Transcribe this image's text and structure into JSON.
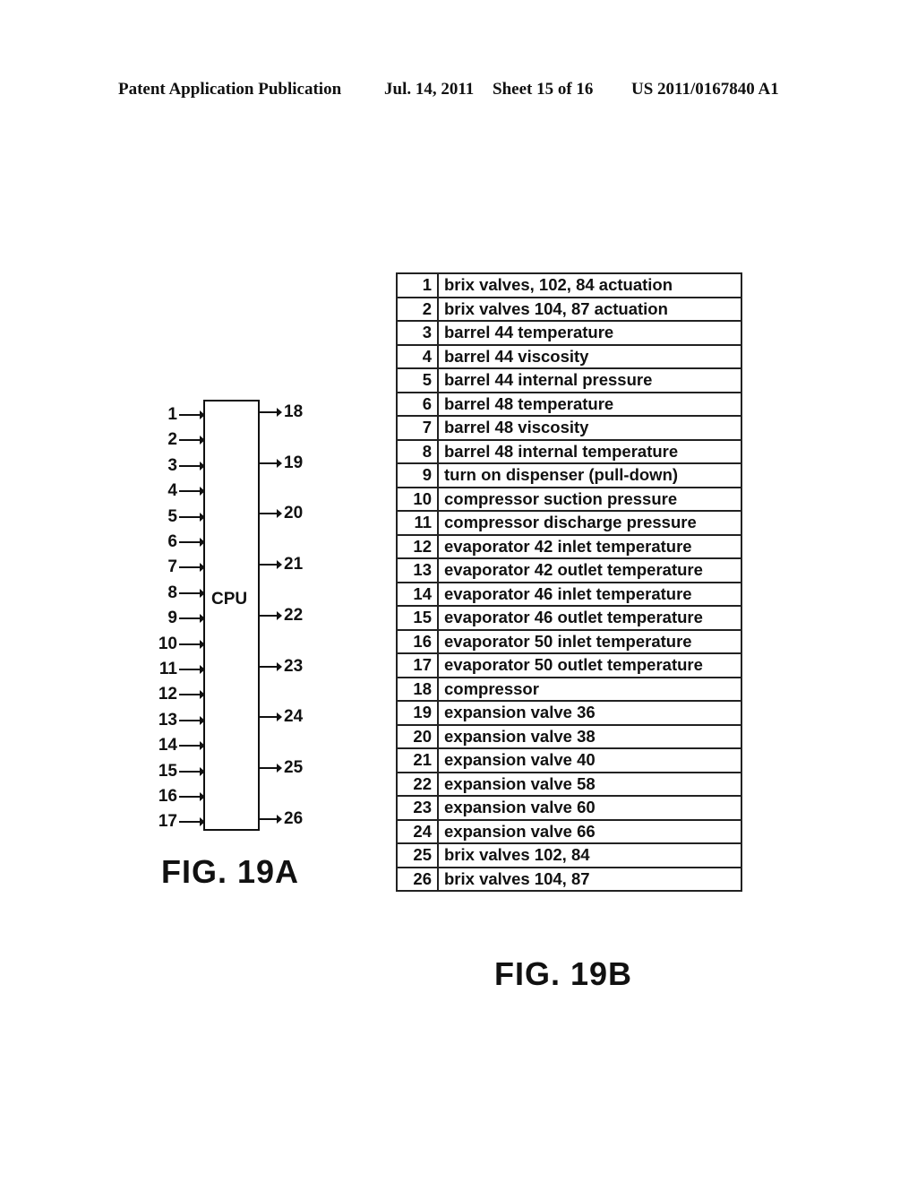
{
  "header": {
    "publication": "Patent Application Publication",
    "date": "Jul. 14, 2011",
    "sheet": "Sheet 15 of 16",
    "number": "US 2011/0167840 A1"
  },
  "fig_a": {
    "cpu_label": "CPU",
    "inputs": [
      "1",
      "2",
      "3",
      "4",
      "5",
      "6",
      "7",
      "8",
      "9",
      "10",
      "11",
      "12",
      "13",
      "14",
      "15",
      "16",
      "17"
    ],
    "outputs": [
      "18",
      "19",
      "20",
      "21",
      "22",
      "23",
      "24",
      "25",
      "26"
    ],
    "caption": "FIG. 19A"
  },
  "fig_b": {
    "rows": [
      {
        "num": "1",
        "desc": "brix valves, 102, 84 actuation"
      },
      {
        "num": "2",
        "desc": "brix valves 104, 87 actuation"
      },
      {
        "num": "3",
        "desc": "barrel 44 temperature"
      },
      {
        "num": "4",
        "desc": "barrel 44 viscosity"
      },
      {
        "num": "5",
        "desc": "barrel 44 internal pressure"
      },
      {
        "num": "6",
        "desc": "barrel 48 temperature"
      },
      {
        "num": "7",
        "desc": "barrel 48 viscosity"
      },
      {
        "num": "8",
        "desc": "barrel 48 internal temperature"
      },
      {
        "num": "9",
        "desc": "turn on dispenser (pull-down)"
      },
      {
        "num": "10",
        "desc": "compressor suction pressure"
      },
      {
        "num": "11",
        "desc": "compressor discharge pressure"
      },
      {
        "num": "12",
        "desc": "evaporator 42 inlet temperature"
      },
      {
        "num": "13",
        "desc": "evaporator 42 outlet temperature"
      },
      {
        "num": "14",
        "desc": "evaporator 46 inlet temperature"
      },
      {
        "num": "15",
        "desc": "evaporator 46 outlet temperature"
      },
      {
        "num": "16",
        "desc": "evaporator 50 inlet temperature"
      },
      {
        "num": "17",
        "desc": "evaporator 50 outlet temperature"
      },
      {
        "num": "18",
        "desc": "compressor"
      },
      {
        "num": "19",
        "desc": "expansion valve 36"
      },
      {
        "num": "20",
        "desc": "expansion valve 38"
      },
      {
        "num": "21",
        "desc": "expansion valve 40"
      },
      {
        "num": "22",
        "desc": "expansion valve 58"
      },
      {
        "num": "23",
        "desc": "expansion valve 60"
      },
      {
        "num": "24",
        "desc": "expansion valve 66"
      },
      {
        "num": "25",
        "desc": "brix valves 102, 84"
      },
      {
        "num": "26",
        "desc": "brix valves 104, 87"
      }
    ],
    "caption": "FIG. 19B"
  }
}
